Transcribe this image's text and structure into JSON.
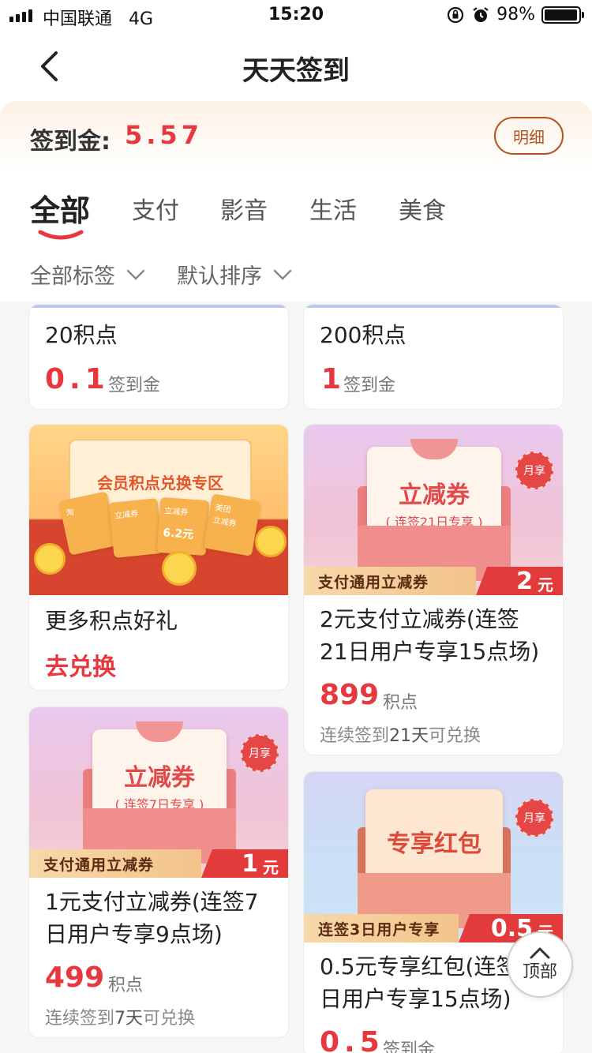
{
  "status_bar": {
    "carrier": "中国联通",
    "network": "4G",
    "time": "15:20",
    "battery": "98%",
    "battery_level": 0.98
  },
  "nav": {
    "title": "天天签到"
  },
  "header": {
    "gold_label": "签到金:",
    "gold_value": "5.57",
    "detail_button": "明细"
  },
  "tabs": [
    {
      "label": "全部",
      "active": true
    },
    {
      "label": "支付",
      "active": false
    },
    {
      "label": "影音",
      "active": false
    },
    {
      "label": "生活",
      "active": false
    },
    {
      "label": "美食",
      "active": false
    }
  ],
  "filters": {
    "tag": "全部标签",
    "sort": "默认排序"
  },
  "cards": {
    "c1": {
      "name": "20积点",
      "price": "0.1",
      "unit": "签到金"
    },
    "c2": {
      "name": "200积点",
      "price": "1",
      "unit": "签到金"
    },
    "c3": {
      "banner_title": "会员积点兑换专区",
      "tickets": [
        "淘",
        "立减券",
        "立减券",
        "美团",
        "立减券"
      ],
      "ticket_amount": "6.2元",
      "name": "更多积点好礼",
      "cta": "去兑换"
    },
    "c4": {
      "letter_title": "立减券",
      "letter_sub": "( 连签21日专享 )",
      "badge": "月享",
      "strip_text": "支付通用立减券",
      "strip_amount": "2",
      "strip_unit": "元",
      "name_line1": "2元支付立减券(连签",
      "name_line2": "21日用户专享15点场)",
      "price": "899",
      "unit": "积点",
      "note_pre": "连续签到",
      "note_days": "21天",
      "note_post": "可兑换"
    },
    "c5": {
      "letter_title": "立减券",
      "letter_sub": "( 连签7日专享 )",
      "badge": "月享",
      "strip_text": "支付通用立减券",
      "strip_amount": "1",
      "strip_unit": "元",
      "name_line1": "1元支付立减券(连签7",
      "name_line2": "日用户专享9点场)",
      "price": "499",
      "unit": "积点",
      "note_pre": "连续签到",
      "note_days": "7天",
      "note_post": "可兑换"
    },
    "c6": {
      "letter_title": "专享红包",
      "badge": "月享",
      "strip_text": "连签3日用户专享",
      "strip_amount": "0.5",
      "strip_unit": "元",
      "name_line1": "0.5元专享红包(连签3",
      "name_line2": "日用户专享15点场)",
      "price": "0.5",
      "unit": "签到金"
    }
  },
  "top_button": "顶部",
  "colors": {
    "accent_red": "#e8383f",
    "brown": "#b5541f"
  }
}
